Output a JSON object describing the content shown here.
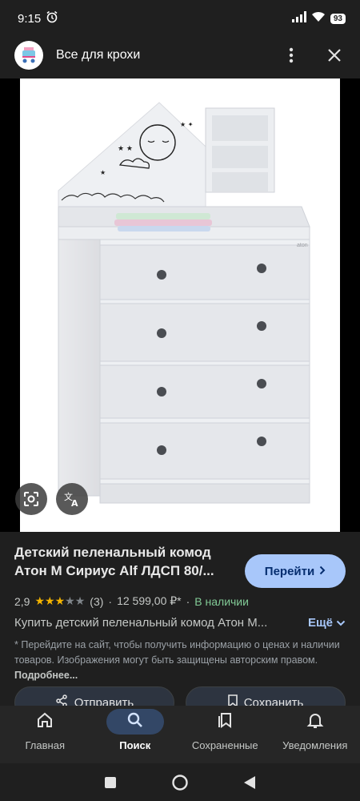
{
  "status": {
    "time": "9:15",
    "battery": "93"
  },
  "header": {
    "site_title": "Все для крохи",
    "icons": [
      "favicon-stroller",
      "more-vert-icon",
      "close-icon"
    ]
  },
  "viewer": {
    "brand_mark": "aton",
    "icons": [
      "lens-icon",
      "translate-icon"
    ]
  },
  "product": {
    "title": "Детский пеленальный комод Атон М Сириус Alf ЛДСП 80/...",
    "goto_label": "Перейти",
    "rating": "2,9",
    "rating_value": 2.9,
    "rating_max": 5,
    "reviews": "(3)",
    "separator": "·",
    "price": "12 599,00 ₽*",
    "availability": "В наличии",
    "description": "Купить детский пеленальный комод Атон М...",
    "more_label": "Ещё",
    "notice": "* Перейдите на сайт, чтобы получить информацию о ценах и наличии товаров. Изображения могут быть защищены авторским правом.",
    "notice_link": "Подробнее..."
  },
  "actions": {
    "share_label": "Отправить",
    "save_label": "Сохранить"
  },
  "bottom_nav": {
    "items": [
      {
        "label": "Главная",
        "icon": "home-icon"
      },
      {
        "label": "Поиск",
        "icon": "search-icon",
        "active": true
      },
      {
        "label": "Сохраненные",
        "icon": "bookmarks-icon"
      },
      {
        "label": "Уведомления",
        "icon": "bell-icon"
      }
    ]
  },
  "colors": {
    "accent": "#a8c7fa",
    "stars": "#f4b400",
    "in_stock": "#81c995",
    "background": "#1f1f1f"
  }
}
